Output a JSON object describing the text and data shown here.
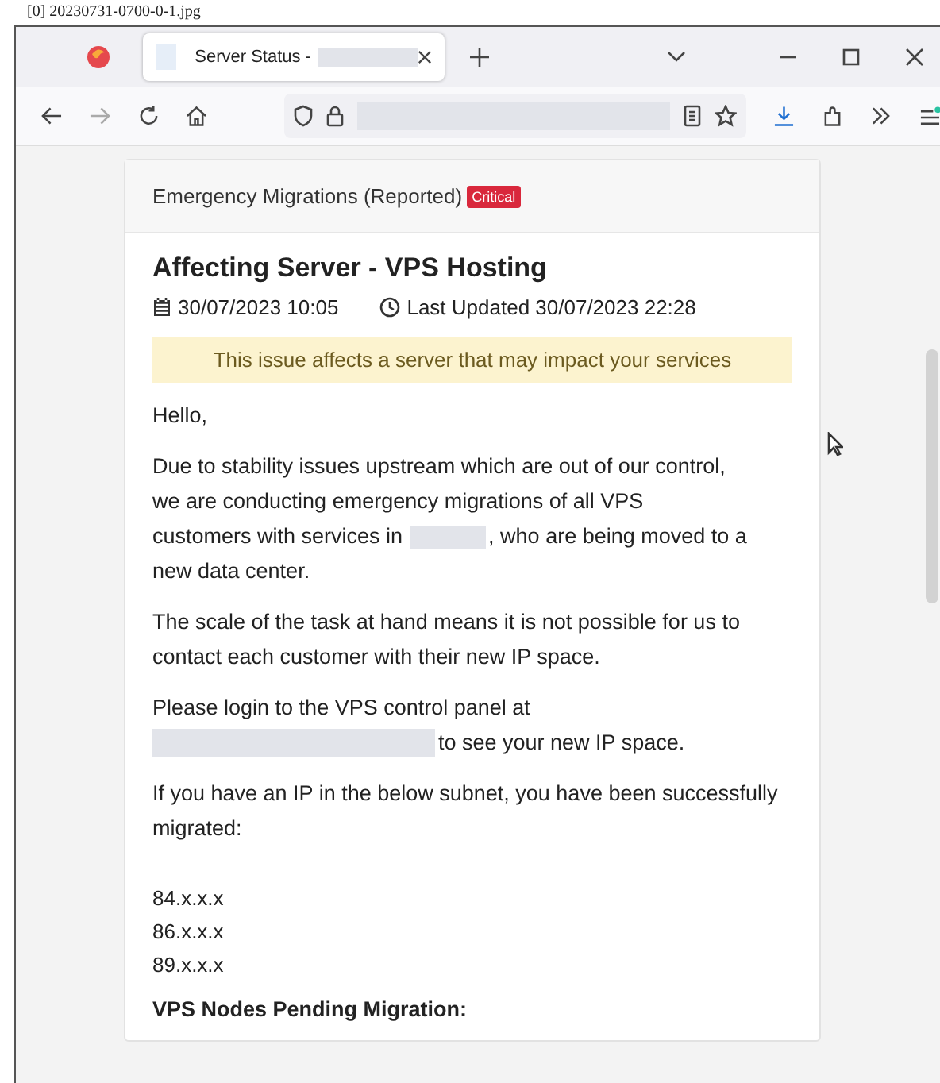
{
  "caption": "[0] 20230731-0700-0-1.jpg",
  "tabs": [
    {
      "title": "Server Status -",
      "selected": true,
      "redacted": true
    }
  ],
  "announcement": {
    "header": "Emergency Migrations (Reported)",
    "badge": "Critical",
    "title": "Affecting Server - VPS Hosting",
    "date": "30/07/2023 10:05",
    "updated": "Last Updated 30/07/2023 22:28",
    "alert": "This issue affects a server that may impact your services",
    "body": [
      {
        "kind": "text",
        "parts": [
          "Hello,"
        ]
      },
      {
        "kind": "redacted",
        "before": [
          "Due to stability issues upstream which are out of our control,",
          "we are conducting emergency migrations of all VPS"
        ],
        "row": [
          "customers with services in",
          ", who are being moved to a"
        ],
        "after": [
          "new data center."
        ]
      },
      {
        "kind": "text",
        "parts": [
          "The scale of the task at hand means it is not possible for us to contact each customer with their new IP space."
        ]
      },
      {
        "kind": "link",
        "parts": [
          "Please login to the VPS control panel at",
          "to see your new IP space."
        ]
      },
      {
        "kind": "text",
        "parts": [
          "If you have an IP in the below subnet, you have been successfully migrated:"
        ]
      },
      {
        "kind": "list",
        "parts": [
          "84.x.x.x",
          "86.x.x.x",
          "89.x.x.x"
        ]
      },
      {
        "kind": "heading",
        "parts": [
          "VPS Nodes Pending Migration:"
        ]
      }
    ]
  }
}
